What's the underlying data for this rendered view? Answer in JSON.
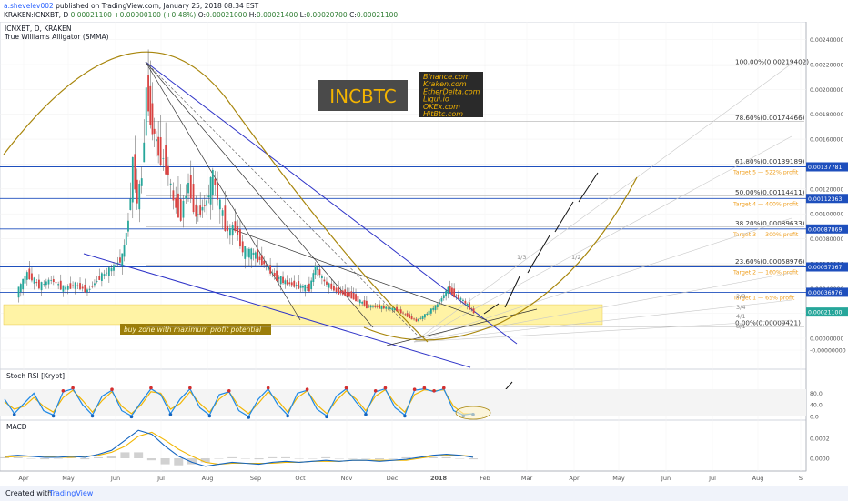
{
  "header": {
    "user": "a.shevelev002",
    "published": "published on TradingView.com, January 25, 2018 08:34 EST",
    "symbol": "KRAKEN:ICNXBT, D",
    "last": "0.00021100",
    "change": "+0.00000100 (+0.48%)",
    "o_label": "O:",
    "o_value": "0.00021000",
    "h_label": "H:",
    "h_value": "0.00021400",
    "l_label": "L:",
    "l_value": "0.00020700",
    "c_label": "C:",
    "c_value": "0.00021100"
  },
  "footer": {
    "created": "Created with",
    "brand": "TradingView"
  },
  "chart_data": {
    "type": "candlestick",
    "title": "ICNXBT, D, KRAKEN",
    "indicator": "True Williams Alligator (SMMA)",
    "x_ticks": [
      "Apr",
      "May",
      "Jun",
      "Jul",
      "Aug",
      "Sep",
      "Oct",
      "Nov",
      "Dec",
      "2018",
      "Feb",
      "Mar",
      "Apr",
      "May",
      "Jun",
      "Jul",
      "Aug",
      "S"
    ],
    "y_ticks": [
      "0.00240000",
      "0.00220000",
      "0.00200000",
      "0.00180000",
      "0.00160000",
      "0.00140000",
      "0.00120000",
      "0.00100000",
      "0.00080000",
      "0.00060000",
      "0.00040000",
      "0.00020000",
      "0.00000000",
      "-0.00000000"
    ],
    "ylim": [
      -0.0001,
      0.0025
    ],
    "price_series": [
      [
        "2017-03-28",
        0.00036
      ],
      [
        "2017-04-04",
        0.00052
      ],
      [
        "2017-04-12",
        0.00042
      ],
      [
        "2017-04-20",
        0.00047
      ],
      [
        "2017-04-28",
        0.0004
      ],
      [
        "2017-05-06",
        0.00043
      ],
      [
        "2017-05-14",
        0.00038
      ],
      [
        "2017-05-22",
        0.00049
      ],
      [
        "2017-05-30",
        0.00056
      ],
      [
        "2017-06-06",
        0.00065
      ],
      [
        "2017-06-10",
        0.00095
      ],
      [
        "2017-06-13",
        0.0014
      ],
      [
        "2017-06-16",
        0.0011
      ],
      [
        "2017-06-19",
        0.0013
      ],
      [
        "2017-06-22",
        0.002
      ],
      [
        "2017-06-26",
        0.0017
      ],
      [
        "2017-06-30",
        0.0015
      ],
      [
        "2017-07-05",
        0.0014
      ],
      [
        "2017-07-10",
        0.0011
      ],
      [
        "2017-07-15",
        0.001
      ],
      [
        "2017-07-20",
        0.00125
      ],
      [
        "2017-07-25",
        0.00098
      ],
      [
        "2017-08-01",
        0.0011
      ],
      [
        "2017-08-05",
        0.0013
      ],
      [
        "2017-08-10",
        0.00105
      ],
      [
        "2017-08-15",
        0.00085
      ],
      [
        "2017-08-20",
        0.0009
      ],
      [
        "2017-08-25",
        0.0007
      ],
      [
        "2017-09-01",
        0.00068
      ],
      [
        "2017-09-08",
        0.0006
      ],
      [
        "2017-09-15",
        0.0005
      ],
      [
        "2017-09-22",
        0.00045
      ],
      [
        "2017-10-01",
        0.00042
      ],
      [
        "2017-10-08",
        0.0004
      ],
      [
        "2017-10-12",
        0.00058
      ],
      [
        "2017-10-18",
        0.00045
      ],
      [
        "2017-10-26",
        0.00038
      ],
      [
        "2017-11-05",
        0.00034
      ],
      [
        "2017-11-15",
        0.00026
      ],
      [
        "2017-11-25",
        0.00025
      ],
      [
        "2017-12-05",
        0.00023
      ],
      [
        "2017-12-12",
        0.00018
      ],
      [
        "2017-12-18",
        0.00014
      ],
      [
        "2017-12-25",
        0.0002
      ],
      [
        "2018-01-01",
        0.00027
      ],
      [
        "2018-01-08",
        0.0004
      ],
      [
        "2018-01-12",
        0.00035
      ],
      [
        "2018-01-18",
        0.0003
      ],
      [
        "2018-01-25",
        0.00021
      ]
    ],
    "fibonacci": [
      {
        "label": "100.00%(0.00219402)",
        "value": 0.00219402
      },
      {
        "label": "78.60%(0.00174466)",
        "value": 0.00174466
      },
      {
        "label": "61.80%(0.00139189)",
        "value": 0.00139189
      },
      {
        "label": "50.00%(0.00114411)",
        "value": 0.00114411
      },
      {
        "label": "38.20%(0.00089633)",
        "value": 0.00089633
      },
      {
        "label": "23.60%(0.00058976)",
        "value": 0.00058976
      },
      {
        "label": "0.00%(0.00009421)",
        "value": 9.421e-05
      }
    ],
    "targets": [
      {
        "label": "Target 5 — 522% profit",
        "value": 0.00137781,
        "badge": "0.00137781"
      },
      {
        "label": "Target 4 — 400% profit",
        "value": 0.00112363,
        "badge": "0.00112363"
      },
      {
        "label": "Target 3 — 300% profit",
        "value": 0.00087869,
        "badge": "0.00087869"
      },
      {
        "label": "Target 2 — 160% profit",
        "value": 0.00057367,
        "badge": "0.00057367"
      },
      {
        "label": "Target 1 — 65% profit",
        "value": 0.00036976,
        "badge": "0.00036976"
      }
    ],
    "current_price_badge": {
      "value": 0.000211,
      "label": "0.00021100"
    },
    "fan_labels": [
      "1/3",
      "1/2",
      "2/3",
      "3/4",
      "4/1",
      "8/1"
    ],
    "annotations": {
      "title_box": "INCBTC",
      "exchanges": [
        "Binance.com",
        "Kraken.com",
        "EtherDelta.com",
        "Liqui.io",
        "OKEx.com",
        "HitBtc.com"
      ],
      "buy_zone": "buy zone with maximum profit potential",
      "buy_zone_range": [
        0.00011,
        0.00027
      ]
    },
    "stoch_rsi": {
      "title": "Stoch RSI [Krypt]",
      "y_ticks": [
        "80.0",
        "40.0",
        "0.0"
      ],
      "ylim": [
        -5,
        105
      ],
      "k": [
        60,
        10,
        45,
        80,
        20,
        5,
        85,
        95,
        40,
        5,
        70,
        90,
        20,
        2,
        50,
        95,
        75,
        10,
        60,
        95,
        30,
        5,
        75,
        85,
        20,
        0,
        60,
        95,
        40,
        5,
        80,
        90,
        25,
        2,
        70,
        95,
        50,
        10,
        85,
        95,
        30,
        5,
        90,
        95,
        85,
        95,
        20,
        5,
        10
      ],
      "d": [
        50,
        25,
        35,
        65,
        35,
        15,
        65,
        90,
        55,
        15,
        55,
        85,
        35,
        10,
        40,
        85,
        80,
        25,
        45,
        85,
        45,
        15,
        60,
        85,
        35,
        10,
        45,
        85,
        55,
        15,
        65,
        88,
        40,
        10,
        55,
        88,
        60,
        20,
        70,
        92,
        45,
        15,
        75,
        92,
        88,
        92,
        35,
        10,
        8
      ]
    },
    "macd": {
      "title": "MACD",
      "y_ticks": [
        "0.0002",
        "0.0000"
      ],
      "ylim": [
        -0.00012,
        0.00035
      ],
      "macd_line": [
        2e-05,
        3e-05,
        2e-05,
        1e-05,
        1e-05,
        2e-05,
        1e-05,
        4e-05,
        8e-05,
        0.00018,
        0.00028,
        0.00024,
        0.00012,
        2e-05,
        -4e-05,
        -8e-05,
        -6e-05,
        -4e-05,
        -5e-05,
        -6e-05,
        -4e-05,
        -3e-05,
        -4e-05,
        -3e-05,
        -2e-05,
        -3e-05,
        -2e-05,
        -2e-05,
        -3e-05,
        -2e-05,
        -1e-05,
        1e-05,
        3e-05,
        4e-05,
        3e-05,
        1e-05
      ],
      "signal_line": [
        1e-05,
        2e-05,
        2e-05,
        2e-05,
        1e-05,
        1e-05,
        2e-05,
        3e-05,
        6e-05,
        0.00012,
        0.00022,
        0.00026,
        0.00018,
        9e-05,
        2e-05,
        -4e-05,
        -6e-05,
        -5e-05,
        -5e-05,
        -5e-05,
        -5e-05,
        -4e-05,
        -4e-05,
        -3e-05,
        -3e-05,
        -3e-05,
        -2e-05,
        -2e-05,
        -2e-05,
        -2e-05,
        -2e-05,
        0.0,
        2e-05,
        3e-05,
        3e-05,
        2e-05
      ]
    },
    "colors": {
      "up": "#26a69a",
      "down": "#d84341",
      "wick": "#555555",
      "fib": "#9e9e9e",
      "target_line": "#1e4fbd",
      "target_text": "#ef9f1f",
      "channel": "#2f34c8",
      "arc": "#a8860c",
      "buy_zone": "#fff3a5",
      "stoch_k": "#1e88e5",
      "stoch_d": "#f2b705",
      "macd_line": "#1565c0",
      "signal_line": "#f2b705",
      "macd_hist": "#c5c5c5"
    }
  }
}
